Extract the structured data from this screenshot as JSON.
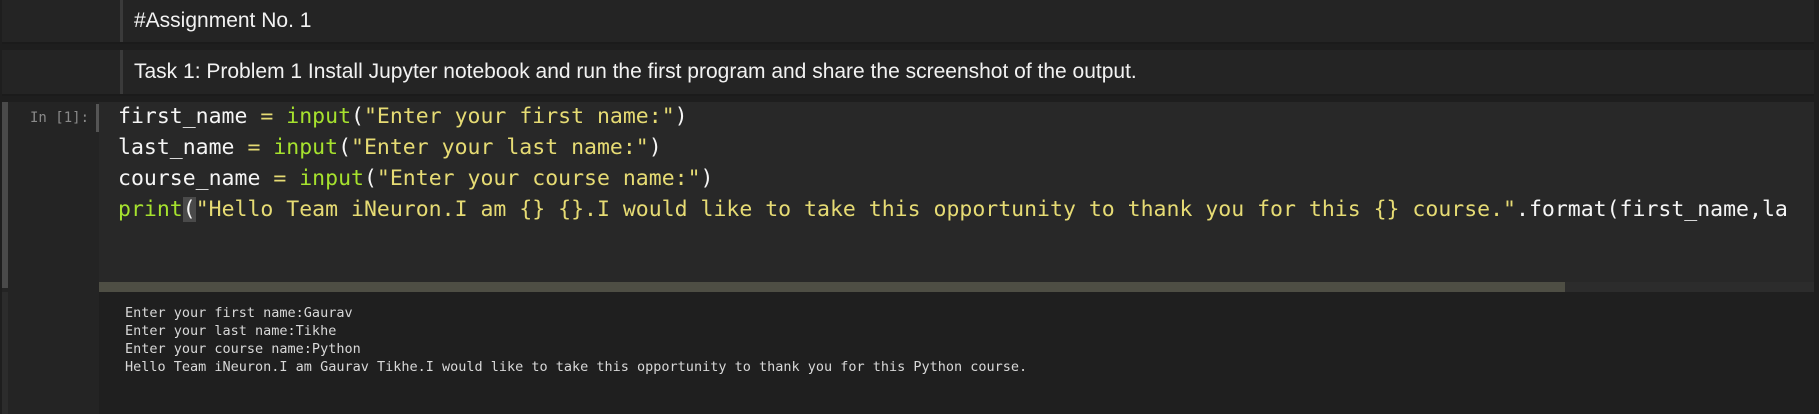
{
  "markdown_cells": [
    {
      "text": "#Assignment No. 1"
    },
    {
      "text": "Task 1: Problem 1 Install Jupyter notebook and run the first program and share the screenshot of the output."
    }
  ],
  "code_cell": {
    "prompt": "In [1]:",
    "lines": [
      {
        "var": "first_name",
        "op": " = ",
        "fn": "input",
        "open": "(",
        "str": "\"Enter your first name:\"",
        "close": ")"
      },
      {
        "var": "last_name",
        "op": " = ",
        "fn": "input",
        "open": "(",
        "str": "\"Enter your last name:\"",
        "close": ")"
      },
      {
        "var": "course_name",
        "op": " = ",
        "fn": "input",
        "open": "(",
        "str": "\"Enter your course name:\"",
        "close": ")"
      }
    ],
    "print_line": {
      "fn": "print",
      "open": "(",
      "str": "\"Hello Team iNeuron.I am {} {}.I would like to take this opportunity to thank you for this {} course.\"",
      "rest": ".format(first_name,la"
    }
  },
  "output": {
    "lines": [
      "Enter your first name:Gaurav",
      "Enter your last name:Tikhe",
      "Enter your course name:Python",
      "Hello Team iNeuron.I am Gaurav Tikhe.I would like to take this opportunity to thank you for this Python course."
    ]
  },
  "colors": {
    "background": "#1e1e1e",
    "cell": "#242424",
    "string": "#e6db74",
    "function": "#a6e22e"
  }
}
